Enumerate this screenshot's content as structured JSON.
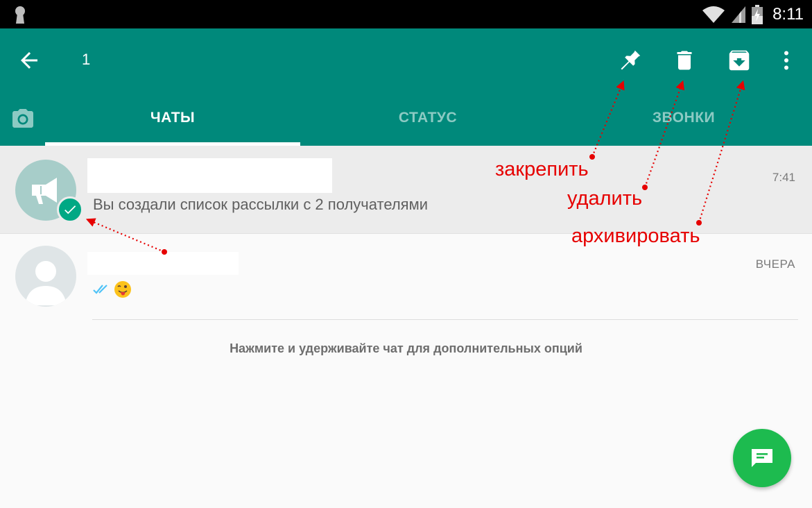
{
  "status_bar": {
    "time": "8:11",
    "icons": [
      "keyhole-icon",
      "wifi-icon",
      "signal-icon",
      "battery-charging-icon"
    ]
  },
  "toolbar": {
    "selected_count": "1",
    "back_icon": "arrow-back-icon",
    "actions": [
      "pin-icon",
      "delete-icon",
      "archive-icon",
      "more-vert-icon"
    ]
  },
  "tabs": {
    "camera_icon": "camera-icon",
    "items": [
      {
        "label": "ЧАТЫ",
        "active": true
      },
      {
        "label": "СТАТУС",
        "active": false
      },
      {
        "label": "ЗВОНКИ",
        "active": false
      }
    ]
  },
  "chats": [
    {
      "avatar": "megaphone-icon",
      "selected": true,
      "preview": "Вы создали список рассылки с 2 получателями",
      "time": "7:41"
    },
    {
      "avatar": "person-icon",
      "selected": false,
      "preview_icons": [
        "double-check-icon",
        "winking-tongue-emoji"
      ],
      "time": "ВЧЕРА"
    }
  ],
  "hint": "Нажмите и удерживайте чат для дополнительных опций",
  "fab_icon": "new-chat-icon",
  "annotations": {
    "pin": "закрепить",
    "delete": "удалить",
    "archive": "архивировать",
    "color": "#e60000"
  },
  "colors": {
    "toolbar": "#00897b",
    "fab": "#1dbb4f",
    "selected_row": "#ececec",
    "badge": "#00a884"
  }
}
